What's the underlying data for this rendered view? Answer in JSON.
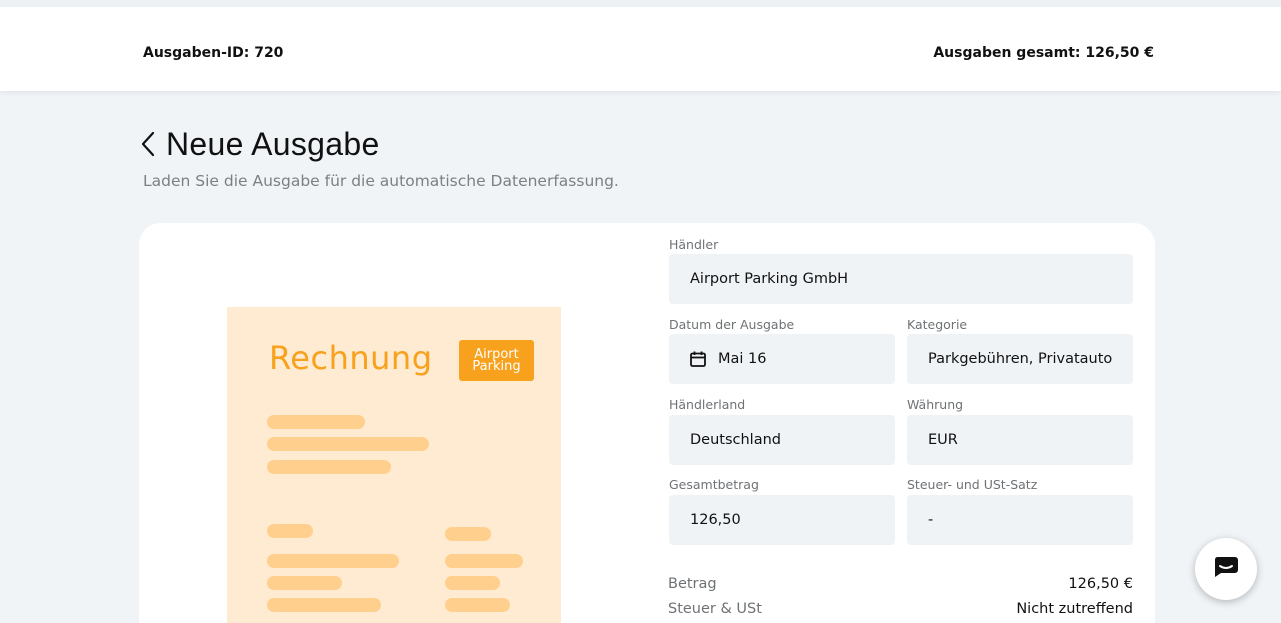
{
  "header": {
    "expense_id": "Ausgaben-ID: 720",
    "total": "Ausgaben gesamt: 126,50 €"
  },
  "page": {
    "title": "Neue Ausgabe",
    "subtitle": "Laden Sie die Ausgabe für die automatische Datenerfassung."
  },
  "receipt": {
    "title": "Rechnung",
    "logo_line1": "Airport",
    "logo_line2": "Parking"
  },
  "form": {
    "merchant": {
      "label": "Händler",
      "value": "Airport Parking GmbH"
    },
    "date": {
      "label": "Datum der Ausgabe",
      "value": "Mai 16"
    },
    "category": {
      "label": "Kategorie",
      "value": "Parkgebühren, Privatauto"
    },
    "country": {
      "label": "Händlerland",
      "value": "Deutschland"
    },
    "currency": {
      "label": "Währung",
      "value": "EUR"
    },
    "total": {
      "label": "Gesamtbetrag",
      "value": "126,50"
    },
    "tax_rate": {
      "label": "Steuer- und USt-Satz",
      "value": "-"
    }
  },
  "summary": {
    "amount_label": "Betrag",
    "amount_value": "126,50 €",
    "tax_label": "Steuer & USt",
    "tax_value": "Nicht zutreffend"
  },
  "colors": {
    "background": "#f0f4f7",
    "receipt_bg": "#ffebd1",
    "receipt_accent": "#f7a11d",
    "receipt_bar": "#ffcf8e",
    "field_bg": "#f0f3f6"
  },
  "icons": {
    "back": "chevron-left-icon",
    "calendar": "calendar-icon",
    "chat": "chat-bubble-icon"
  }
}
